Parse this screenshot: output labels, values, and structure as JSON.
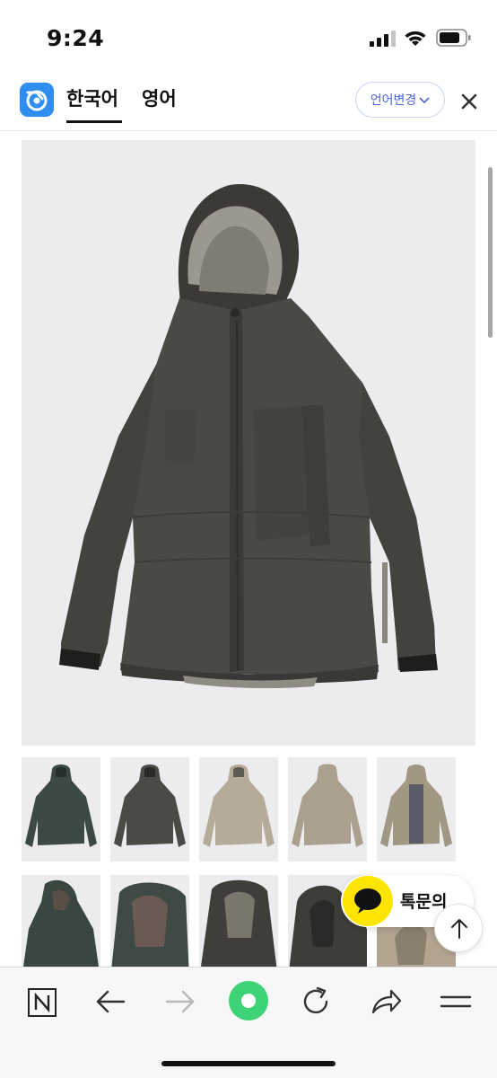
{
  "status_bar": {
    "time": "9:24",
    "icons": [
      "signal-icon",
      "wifi-icon",
      "battery-icon"
    ]
  },
  "language_bar": {
    "logo": "translate-logo-icon",
    "tabs": [
      {
        "label": "한국어",
        "active": true
      },
      {
        "label": "영어",
        "active": false
      }
    ],
    "change_button": "언어변경",
    "close_icon": "close-icon"
  },
  "product": {
    "main_image": "hooded shell jacket, charcoal",
    "thumbnails": [
      {
        "color": "#3d4a44",
        "alt": "dark green jacket"
      },
      {
        "color": "#4b4a47",
        "alt": "charcoal jacket"
      },
      {
        "color": "#b6ab98",
        "alt": "beige jacket front"
      },
      {
        "color": "#ab9f8d",
        "alt": "beige jacket back"
      },
      {
        "color": "#a09883",
        "alt": "beige jacket open"
      },
      {
        "color": "#3a4740",
        "alt": "green hood detail"
      },
      {
        "color": "#3e4a43",
        "alt": "green hood open"
      },
      {
        "color": "#565049",
        "alt": "hood detail"
      },
      {
        "color": "#3f3d3a",
        "alt": "dark hood"
      },
      {
        "color": "#b1a491",
        "alt": "beige hood"
      }
    ]
  },
  "floating": {
    "chat_label": "톡문의",
    "chat_icon": "kakao-chat-icon",
    "top_icon": "arrow-up-icon"
  },
  "browser_bar": {
    "buttons": [
      "naver-icon",
      "back-arrow-icon",
      "forward-arrow-icon",
      "green-dot-icon",
      "refresh-icon",
      "share-icon",
      "menu-icon"
    ]
  },
  "colors": {
    "accent": "#4a63d8",
    "logo": "#2e8ef0",
    "kakao": "#fee500",
    "naver_green": "#3fd377"
  }
}
